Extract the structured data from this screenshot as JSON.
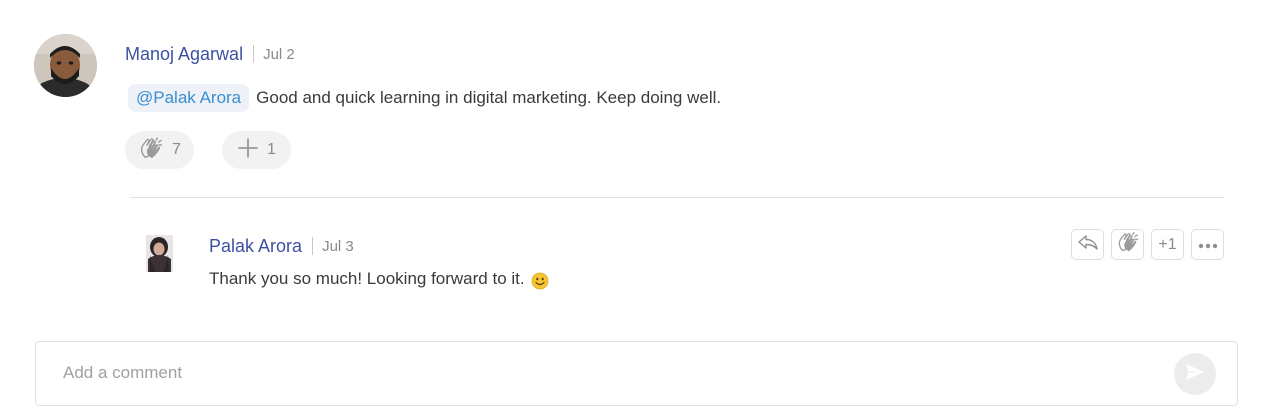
{
  "comment": {
    "author": "Manoj Agarwal",
    "date": "Jul 2",
    "mention": "@Palak Arora",
    "text": "Good and quick learning in digital marketing. Keep doing well.",
    "reactions": {
      "clap_count": "7",
      "plus_count": "1",
      "clap_icon": "clap-icon",
      "plus_icon": "plus-icon"
    }
  },
  "reply": {
    "author": "Palak Arora",
    "date": "Jul 3",
    "text": "Thank you so much! Looking forward to it.",
    "emoji_icon": "smiley-icon",
    "actions": {
      "reply_icon": "reply-icon",
      "clap_icon": "clap-icon",
      "plus_one_label": "+1",
      "more_icon": "more-icon"
    }
  },
  "composer": {
    "placeholder": "Add a comment",
    "value": "",
    "send_icon": "send-icon"
  },
  "colors": {
    "author_name": "#3d51a3",
    "mention_text": "#3a8fcf",
    "mention_bg": "#eef1f7"
  }
}
